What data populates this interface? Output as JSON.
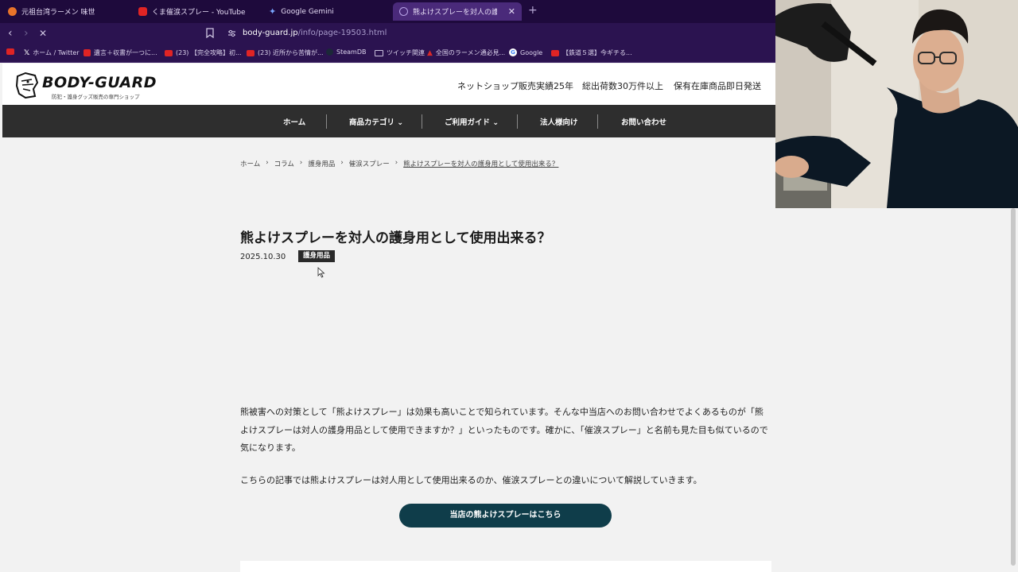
{
  "browser": {
    "tabs": [
      {
        "label": "元祖台湾ラーメン 味世",
        "fav_color": "#e8742a"
      },
      {
        "label": "くま催涙スプレー - YouTube",
        "fav_color": "#e02424"
      },
      {
        "label": "Google Gemini",
        "fav_color": "#7aa7ff"
      },
      {
        "label": "熊よけスプレーを対人の護身用として",
        "fav_color": "#b9a4e8"
      }
    ],
    "close_glyph": "✕",
    "new_tab_glyph": "+",
    "url_host": "body-guard.jp",
    "url_path": "/info/page-19503.html",
    "bookmarks": [
      {
        "label": "",
        "color": "#e02424"
      },
      {
        "label": "ホーム / Twitter",
        "color": "#000000"
      },
      {
        "label": "遺言＋収書が一つに...",
        "color": "#e02424"
      },
      {
        "label": "(23) 【完全攻略】初...",
        "color": "#e02424"
      },
      {
        "label": "(23) 近所から苦情が...",
        "color": "#e02424"
      },
      {
        "label": "SteamDB",
        "color": "#1b2838"
      },
      {
        "label": "ツイッチ関連",
        "color": "#c9c0dc"
      },
      {
        "label": "全国のラーメン通必見...",
        "color": "#d62828"
      },
      {
        "label": "Google",
        "color": "#ffffff"
      },
      {
        "label": "【鉄道５選】今ギチる...",
        "color": "#e02424"
      }
    ]
  },
  "site": {
    "logo_text": "BODY-GUARD",
    "logo_sub": "防犯・護身グッズ販売の専門ショップ",
    "claims": [
      "ネットショップ販売実績25年",
      "総出荷数30万件以上",
      "保有在庫商品即日発送"
    ],
    "nav": [
      {
        "label": "ホーム"
      },
      {
        "label": "商品カテゴリ ⌄"
      },
      {
        "label": "ご利用ガイド ⌄"
      },
      {
        "label": "法人様向け"
      },
      {
        "label": "お問い合わせ"
      }
    ]
  },
  "breadcrumb": {
    "items": [
      "ホーム",
      "コラム",
      "護身用品",
      "催涙スプレー"
    ],
    "current": "熊よけスプレーを対人の護身用として使用出来る？",
    "separator": "›"
  },
  "article": {
    "title": "熊よけスプレーを対人の護身用として使用出来る？",
    "date": "2025.10.30",
    "category": "護身用品",
    "paragraphs": [
      "熊被害への対策として「熊よけスプレー」は効果も高いことで知られています。そんな中当店へのお問い合わせでよくあるものが「熊よけスプレーは対人の護身用品として使用できますか？」といったものです。確かに、「催涙スプレー」と名前も見た目も似ているので気になります。",
      "こちらの記事では熊よけスプレーは対人用として使用出来るのか、催涙スプレーとの違いについて解説していきます。"
    ],
    "cta_label": "当店の熊よけスプレーはこちら"
  },
  "colors": {
    "nav_bg": "#2e2e2e",
    "cta_bg": "#0f3d4a",
    "browser_bg": "#2b1350"
  }
}
